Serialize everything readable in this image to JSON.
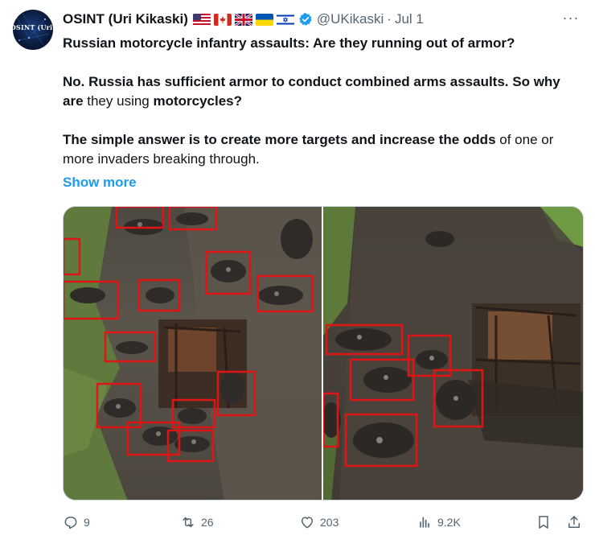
{
  "author": {
    "display_name": "OSINT (Uri Kikaski)",
    "flags": [
      "us-flag",
      "canada-flag",
      "uk-flag",
      "ukraine-flag",
      "israel-flag"
    ],
    "verified": true,
    "handle": "@UKikaski",
    "separator": "·",
    "date": "Jul 1",
    "avatar_text": "OSINT (Uri)"
  },
  "tweet": {
    "title": "Russian motorcycle infantry assaults: Are they running out of armor?",
    "p2_part1": "No. Russia has sufficient armor to conduct combined arms assaults. So why are",
    "p2_part2": " they using ",
    "p2_part3": "motorcycles?",
    "p3_bold": "The simple answer is to create more targets and increase the odds",
    "p3_normal": " of one or more invaders breaking through.",
    "show_more": "Show more"
  },
  "menu": {
    "more_label": "···"
  },
  "stats": {
    "replies": "9",
    "reposts": "26",
    "likes": "203",
    "views": "9.2K"
  },
  "colors": {
    "accent": "#1d9bf0",
    "secondary_text": "#536471",
    "highlight_box": "#e01414"
  },
  "icons": {
    "reply": "reply-icon",
    "repost": "repost-icon",
    "like": "heart-icon",
    "views": "views-icon",
    "bookmark": "bookmark-icon",
    "share": "share-icon",
    "more": "more-icon"
  }
}
